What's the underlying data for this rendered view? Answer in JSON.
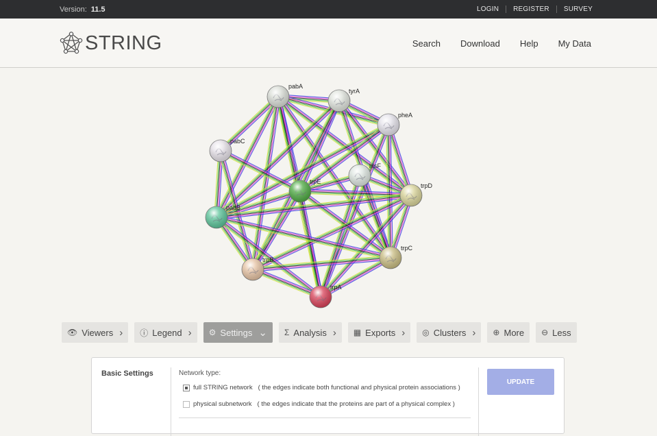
{
  "topbar": {
    "version_label": "Version:",
    "version_value": "11.5",
    "login": "LOGIN",
    "register": "REGISTER",
    "survey": "SURVEY"
  },
  "header": {
    "logo_text": "STRING",
    "nav": [
      "Search",
      "Download",
      "Help",
      "My Data"
    ]
  },
  "network": {
    "nodes": [
      {
        "id": "pabA",
        "label": "pabA",
        "color": "#d9ddd6"
      },
      {
        "id": "tyrA",
        "label": "tyrA",
        "color": "#dfe3dc"
      },
      {
        "id": "pheA",
        "label": "pheA",
        "color": "#e4e2ea"
      },
      {
        "id": "pabC",
        "label": "pabC",
        "color": "#e6e1e8"
      },
      {
        "id": "hisF",
        "label": "hisF",
        "color": "#dde5e0"
      },
      {
        "id": "trpE",
        "label": "trpE",
        "color": "#4faa44"
      },
      {
        "id": "trpD",
        "label": "trpD",
        "color": "#d9d49a"
      },
      {
        "id": "pabB",
        "label": "pabB",
        "color": "#5cc49a"
      },
      {
        "id": "trpC",
        "label": "trpC",
        "color": "#c9bd83"
      },
      {
        "id": "trpB",
        "label": "trpB",
        "color": "#e6c3a4"
      },
      {
        "id": "trpA",
        "label": "trpA",
        "color": "#d9435a"
      }
    ],
    "edge_colors": [
      "#3a3fe0",
      "#e03ad2",
      "#222222",
      "#3fbf3f",
      "#cfe03a"
    ]
  },
  "toolbar": [
    {
      "id": "viewers",
      "label": "Viewers",
      "icon": "eye-icon",
      "glyph": "👁",
      "chevron": "›",
      "active": false
    },
    {
      "id": "legend",
      "label": "Legend",
      "icon": "info-icon",
      "glyph": "ⓘ",
      "chevron": "›",
      "active": false
    },
    {
      "id": "settings",
      "label": "Settings",
      "icon": "gear-icon",
      "glyph": "⚙",
      "chevron": "⌄",
      "active": true
    },
    {
      "id": "analysis",
      "label": "Analysis",
      "icon": "sigma-icon",
      "glyph": "Σ",
      "chevron": "›",
      "active": false
    },
    {
      "id": "exports",
      "label": "Exports",
      "icon": "table-icon",
      "glyph": "▦",
      "chevron": "›",
      "active": false
    },
    {
      "id": "clusters",
      "label": "Clusters",
      "icon": "clusters-icon",
      "glyph": "◎",
      "chevron": "›",
      "active": false
    },
    {
      "id": "more",
      "label": "More",
      "icon": "plus-circle-icon",
      "glyph": "⊕",
      "chevron": "",
      "active": false
    },
    {
      "id": "less",
      "label": "Less",
      "icon": "minus-circle-icon",
      "glyph": "⊖",
      "chevron": "",
      "active": false
    }
  ],
  "settings": {
    "title": "Basic Settings",
    "network_type_label": "Network type:",
    "options": [
      {
        "label": "full STRING network",
        "desc": "( the edges indicate both functional and physical protein associations )",
        "checked": true
      },
      {
        "label": "physical subnetwork",
        "desc": "( the edges indicate that the proteins are part of a physical complex )",
        "checked": false
      }
    ],
    "update_label": "UPDATE"
  }
}
